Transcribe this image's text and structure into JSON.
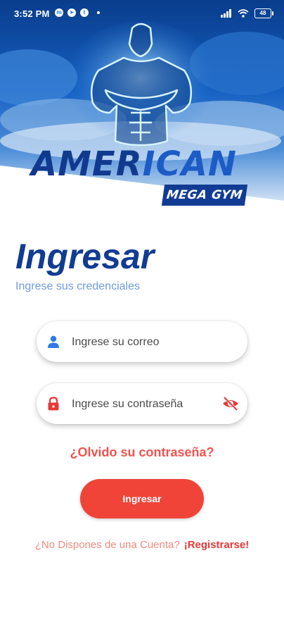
{
  "status_bar": {
    "time": "3:52 PM",
    "battery": "48",
    "notif_icons": [
      "messenger-icon",
      "telegram-icon",
      "twitter-icon"
    ],
    "right_icons": [
      "signal-icon",
      "wifi-icon",
      "battery-icon"
    ]
  },
  "logo": {
    "word_part1": "AMER",
    "word_part2": "ICAN",
    "tagline": "MEGA GYM"
  },
  "form": {
    "title": "Ingresar",
    "subtitle": "Ingrese sus credenciales",
    "email_placeholder": "Ingrese su correo",
    "email_value": "",
    "password_placeholder": "Ingrese su contraseña",
    "password_value": "",
    "forgot_label": "¿Olvido su contraseña?",
    "submit_label": "Ingresar",
    "signup_question": "¿No Dispones de una Cuenta?",
    "signup_link": "¡Registrarse!"
  },
  "colors": {
    "brand_dark": "#123c93",
    "brand_light": "#6e9be3",
    "accent": "#f04438",
    "link": "#e53935"
  }
}
